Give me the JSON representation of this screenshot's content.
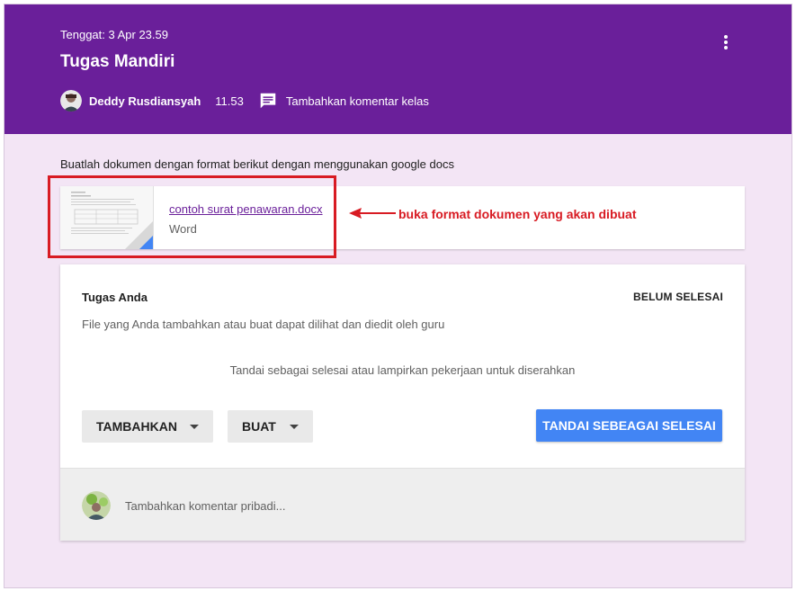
{
  "header": {
    "due": "Tenggat: 3 Apr 23.59",
    "title": "Tugas Mandiri",
    "author": "Deddy Rusdiansyah",
    "time": "11.53",
    "class_comment_label": "Tambahkan komentar kelas",
    "background_color": "#6a1f9a"
  },
  "instructions": "Buatlah dokumen dengan format berikut dengan menggunakan google docs",
  "attachment": {
    "file_name": "contoh surat penawaran.docx",
    "file_type": "Word",
    "icon": "word-document-icon"
  },
  "annotation": {
    "text": "buka format dokumen yang akan dibuat",
    "color": "#d81b23"
  },
  "your_work": {
    "title": "Tugas Anda",
    "status": "BELUM SELESAI",
    "subtitle": "File yang Anda tambahkan atau buat dapat dilihat dan diedit oleh guru",
    "hint": "Tandai sebagai selesai atau lampirkan pekerjaan untuk diserahkan",
    "add_label": "TAMBAHKAN",
    "create_label": "BUAT",
    "mark_done_label": "TANDAI SEBEAGAI SELESAI",
    "primary_color": "#4285f4"
  },
  "private_comment": {
    "placeholder": "Tambahkan komentar pribadi..."
  }
}
